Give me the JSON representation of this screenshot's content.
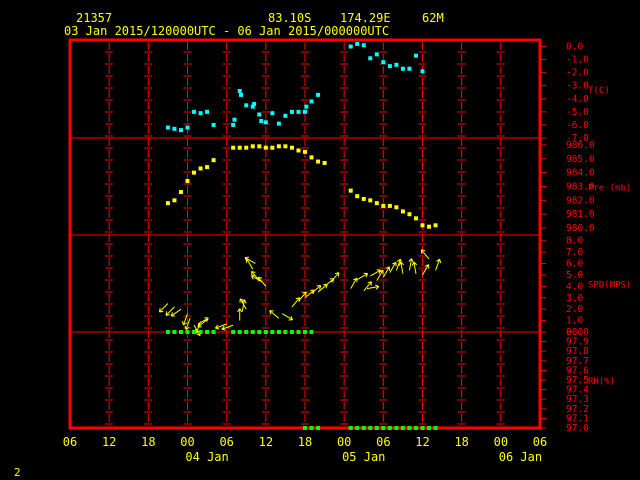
{
  "header": {
    "station_id": "21357",
    "latitude": "83.10S",
    "longitude": "174.29E",
    "elevation": "62M",
    "period": "03 Jan 2015/120000UTC - 06 Jan 2015/000000UTC"
  },
  "footer": {
    "page_number": "2"
  },
  "colors": {
    "frame": "#ff0000",
    "text": "#ffff00",
    "temp": "#00ffff",
    "pressure": "#ffff00",
    "wind": "#ffff00",
    "rh": "#00ff00"
  },
  "chart_data": {
    "type": "scatter",
    "x": {
      "unit": "hours since 03 Jan 2015 06UTC",
      "range": [
        0,
        72
      ],
      "tick_labels": [
        "06",
        "12",
        "18",
        "00",
        "06",
        "12",
        "18",
        "00",
        "06",
        "12",
        "18",
        "00",
        "06"
      ],
      "day_labels": [
        {
          "label": "04 Jan",
          "hour": 21
        },
        {
          "label": "05 Jan",
          "hour": 45
        },
        {
          "label": "06 Jan",
          "hour": 69
        }
      ]
    },
    "panels": [
      {
        "name": "T(C)",
        "type": "scatter",
        "ylim": [
          -7.0,
          0.5
        ],
        "tick_labels": [
          "0.0",
          "-1.0",
          "-2.0",
          "-3.0",
          "-4.0",
          "-5.0",
          "-6.0",
          "-7.0"
        ],
        "tick_values": [
          0.0,
          -1.0,
          -2.0,
          -3.0,
          -4.0,
          -5.0,
          -6.0,
          -7.0
        ],
        "color": "#00ffff",
        "points": [
          [
            15,
            -6.2
          ],
          [
            16,
            -6.3
          ],
          [
            17,
            -6.4
          ],
          [
            18,
            -6.2
          ],
          [
            19,
            -5.0
          ],
          [
            20,
            -5.1
          ],
          [
            21,
            -5.0
          ],
          [
            22,
            -6.0
          ],
          [
            25,
            -6.0
          ],
          [
            25.2,
            -5.6
          ],
          [
            26,
            -3.4
          ],
          [
            26.2,
            -3.7
          ],
          [
            27,
            -4.5
          ],
          [
            28,
            -4.6
          ],
          [
            28.2,
            -4.4
          ],
          [
            29,
            -5.2
          ],
          [
            29.3,
            -5.7
          ],
          [
            30,
            -5.8
          ],
          [
            31,
            -5.1
          ],
          [
            32,
            -5.9
          ],
          [
            33,
            -5.3
          ],
          [
            34,
            -5.0
          ],
          [
            35,
            -5.0
          ],
          [
            36,
            -5.0
          ],
          [
            36.2,
            -4.6
          ],
          [
            37,
            -4.2
          ],
          [
            38,
            -3.7
          ],
          [
            43,
            0.0
          ],
          [
            44,
            0.2
          ],
          [
            45,
            0.1
          ],
          [
            46,
            -0.9
          ],
          [
            47,
            -0.6
          ],
          [
            48,
            -1.2
          ],
          [
            49,
            -1.5
          ],
          [
            50,
            -1.4
          ],
          [
            51,
            -1.7
          ],
          [
            52,
            -1.7
          ],
          [
            53,
            -0.7
          ],
          [
            54,
            -1.9
          ]
        ]
      },
      {
        "name": "Pre (mb)",
        "type": "scatter",
        "ylim": [
          979.5,
          986.5
        ],
        "tick_labels": [
          "986.0",
          "985.0",
          "984.0",
          "983.0",
          "982.0",
          "981.0",
          "980.0"
        ],
        "tick_values": [
          986,
          985,
          984,
          983,
          982,
          981,
          980
        ],
        "color": "#ffff00",
        "points": [
          [
            15,
            981.8
          ],
          [
            16,
            982.0
          ],
          [
            17,
            982.6
          ],
          [
            18,
            983.4
          ],
          [
            19,
            984.0
          ],
          [
            20,
            984.3
          ],
          [
            21,
            984.4
          ],
          [
            22,
            984.9
          ],
          [
            25,
            985.8
          ],
          [
            26,
            985.8
          ],
          [
            27,
            985.8
          ],
          [
            28,
            985.9
          ],
          [
            29,
            985.9
          ],
          [
            30,
            985.8
          ],
          [
            31,
            985.8
          ],
          [
            32,
            985.9
          ],
          [
            33,
            985.9
          ],
          [
            34,
            985.8
          ],
          [
            35,
            985.6
          ],
          [
            36,
            985.5
          ],
          [
            37,
            985.1
          ],
          [
            38,
            984.8
          ],
          [
            39,
            984.7
          ],
          [
            43,
            982.7
          ],
          [
            44,
            982.3
          ],
          [
            45,
            982.1
          ],
          [
            46,
            982.0
          ],
          [
            47,
            981.8
          ],
          [
            48,
            981.6
          ],
          [
            49,
            981.6
          ],
          [
            50,
            981.5
          ],
          [
            51,
            981.2
          ],
          [
            52,
            981.0
          ],
          [
            53,
            980.7
          ],
          [
            54,
            980.2
          ],
          [
            55,
            980.1
          ],
          [
            56,
            980.2
          ]
        ]
      },
      {
        "name": "SPD(MPS)",
        "type": "scatter",
        "ylim": [
          0.0,
          8.5
        ],
        "tick_labels": [
          "8.0",
          "7.0",
          "6.0",
          "5.0",
          "4.0",
          "3.0",
          "2.0",
          "1.0",
          "0.0"
        ],
        "tick_values": [
          8,
          7,
          6,
          5,
          4,
          3,
          2,
          1,
          0
        ],
        "color": "#ffff00",
        "points": [
          [
            15,
            2.5
          ],
          [
            16,
            2.2
          ],
          [
            17,
            2.0
          ],
          [
            18,
            1.6
          ],
          [
            18.4,
            1.2
          ],
          [
            19,
            0.6
          ],
          [
            19.6,
            0.7
          ],
          [
            20,
            0.9
          ],
          [
            21,
            1.1
          ],
          [
            24,
            0.7
          ],
          [
            25,
            0.6
          ],
          [
            26,
            1.0
          ],
          [
            26.4,
            1.8
          ],
          [
            27,
            2.0
          ],
          [
            28,
            5.5
          ],
          [
            28.4,
            6.0
          ],
          [
            29,
            4.5
          ],
          [
            29.4,
            4.4
          ],
          [
            30,
            4.0
          ],
          [
            32,
            1.2
          ],
          [
            32.5,
            1.6
          ],
          [
            34,
            2.2
          ],
          [
            35,
            2.7
          ],
          [
            36,
            3.0
          ],
          [
            37,
            3.4
          ],
          [
            38,
            3.5
          ],
          [
            39,
            4.0
          ],
          [
            40,
            4.4
          ],
          [
            43,
            3.8
          ],
          [
            44,
            4.6
          ],
          [
            45,
            3.6
          ],
          [
            45.5,
            3.8
          ],
          [
            46,
            4.9
          ],
          [
            47,
            4.5
          ],
          [
            48,
            4.8
          ],
          [
            49,
            5.2
          ],
          [
            50,
            5.4
          ],
          [
            51,
            5.1
          ],
          [
            52,
            5.4
          ],
          [
            53,
            5.1
          ],
          [
            54,
            5.0
          ],
          [
            55,
            6.4
          ],
          [
            56,
            5.4
          ]
        ],
        "directions_deg": [
          225,
          225,
          235,
          200,
          200,
          150,
          60,
          200,
          230,
          250,
          250,
          0,
          10,
          330,
          330,
          300,
          320,
          300,
          320,
          310,
          120,
          40,
          40,
          50,
          50,
          50,
          50,
          40,
          30,
          60,
          40,
          80,
          60,
          30,
          30,
          30,
          20,
          350,
          10,
          350,
          30,
          320,
          20
        ]
      },
      {
        "name": "RH(%)",
        "type": "scatter",
        "ylim": [
          97.0,
          98.0
        ],
        "tick_labels": [
          "98.0",
          "97.9",
          "97.8",
          "97.7",
          "97.6",
          "97.5",
          "97.4",
          "97.3",
          "97.2",
          "97.1",
          "97.0"
        ],
        "tick_values": [
          98.0,
          97.9,
          97.8,
          97.7,
          97.6,
          97.5,
          97.4,
          97.3,
          97.2,
          97.1,
          97.0
        ],
        "color": "#00ff00",
        "points": [
          [
            15,
            98
          ],
          [
            16,
            98
          ],
          [
            17,
            98
          ],
          [
            18,
            98
          ],
          [
            19,
            98
          ],
          [
            20,
            98
          ],
          [
            21,
            98
          ],
          [
            22,
            98
          ],
          [
            25,
            98
          ],
          [
            26,
            98
          ],
          [
            27,
            98
          ],
          [
            28,
            98
          ],
          [
            29,
            98
          ],
          [
            30,
            98
          ],
          [
            31,
            98
          ],
          [
            32,
            98
          ],
          [
            33,
            98
          ],
          [
            34,
            98
          ],
          [
            35,
            98
          ],
          [
            36,
            98
          ],
          [
            37,
            98
          ],
          [
            36,
            97
          ],
          [
            37,
            97
          ],
          [
            38,
            97
          ],
          [
            43,
            97
          ],
          [
            44,
            97
          ],
          [
            45,
            97
          ],
          [
            46,
            97
          ],
          [
            47,
            97
          ],
          [
            48,
            97
          ],
          [
            49,
            97
          ],
          [
            50,
            97
          ],
          [
            51,
            97
          ],
          [
            52,
            97
          ],
          [
            53,
            97
          ],
          [
            54,
            97
          ],
          [
            55,
            97
          ],
          [
            56,
            97
          ]
        ]
      }
    ]
  }
}
